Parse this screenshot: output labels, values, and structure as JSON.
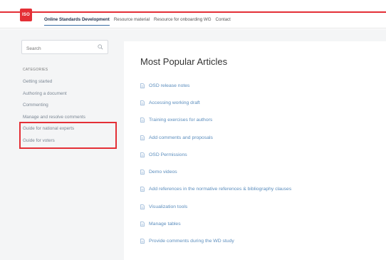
{
  "header": {
    "logo_text": "ISO",
    "nav": [
      {
        "label": "Online Standards Development",
        "active": true
      },
      {
        "label": "Resource material",
        "active": false
      },
      {
        "label": "Resource for onboarding WG",
        "active": false
      },
      {
        "label": "Contact",
        "active": false
      }
    ]
  },
  "sidebar": {
    "search_placeholder": "Search",
    "categories_title": "CATEGORIES",
    "categories": [
      "Getting started",
      "Authoring a document",
      "Commenting",
      "Manage and resolve comments",
      "Guide for national experts",
      "Guide for voters"
    ]
  },
  "main": {
    "title": "Most Popular Articles",
    "articles": [
      "OSD release notes",
      "Accessing working draft",
      "Training exercises for authors",
      "Add comments and proposals",
      "OSD Permissions",
      "Demo videos",
      "Add references in the normative references & bibliography clauses",
      "Visualization tools",
      "Manage tables",
      "Provide comments during the WD study"
    ]
  },
  "colors": {
    "accent_red": "#e42f36",
    "link_blue": "#5b8dbd",
    "background": "#f4f5f6"
  }
}
